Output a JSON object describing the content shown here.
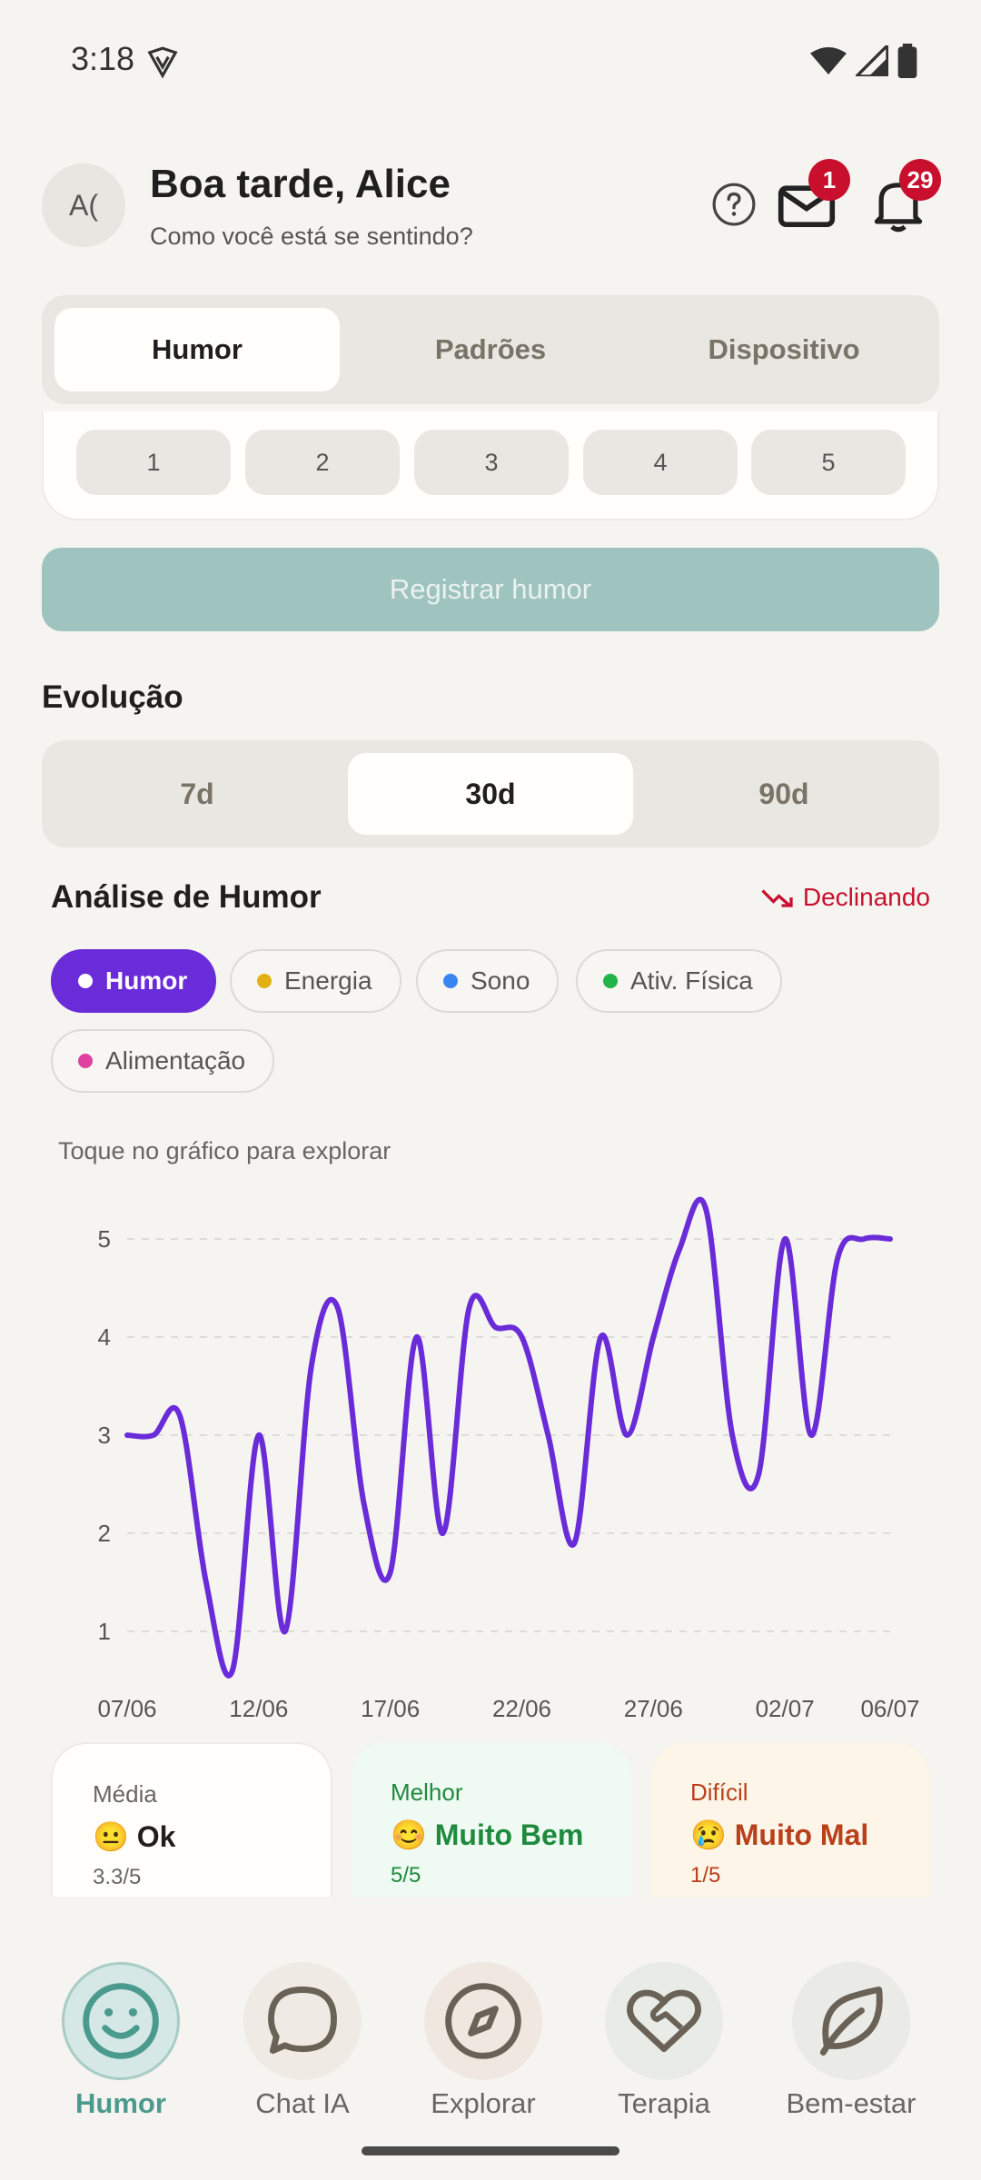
{
  "status_bar": {
    "time": "3:18"
  },
  "header": {
    "avatar_initials": "A(",
    "greeting": "Boa tarde, Alice",
    "subtitle": "Como você está se sentindo?",
    "mail_badge": "1",
    "bell_badge": "29"
  },
  "main_tabs": [
    "Humor",
    "Padrões",
    "Dispositivo"
  ],
  "rating_options": [
    "1",
    "2",
    "3",
    "4",
    "5"
  ],
  "register_button": "Registrar humor",
  "section_title": "Evolução",
  "range_tabs": [
    "7d",
    "30d",
    "90d"
  ],
  "analysis": {
    "title": "Análise de Humor",
    "trend": "Declinando",
    "chips": [
      {
        "label": "Humor",
        "color": "#6a2bd8",
        "active": true
      },
      {
        "label": "Energia",
        "color": "#e1b012",
        "active": false
      },
      {
        "label": "Sono",
        "color": "#3a86f0",
        "active": false
      },
      {
        "label": "Ativ. Física",
        "color": "#22b34a",
        "active": false
      },
      {
        "label": "Alimentação",
        "color": "#e040a0",
        "active": false
      }
    ],
    "hint": "Toque no gráfico para explorar"
  },
  "chart_data": {
    "type": "line",
    "x": [
      "07/06",
      "08/06",
      "09/06",
      "10/06",
      "11/06",
      "12/06",
      "13/06",
      "14/06",
      "15/06",
      "16/06",
      "17/06",
      "18/06",
      "19/06",
      "20/06",
      "21/06",
      "22/06",
      "23/06",
      "24/06",
      "25/06",
      "26/06",
      "27/06",
      "28/06",
      "29/06",
      "30/06",
      "01/07",
      "02/07",
      "03/07",
      "04/07",
      "05/07",
      "06/07"
    ],
    "tick_labels": [
      "07/06",
      "12/06",
      "17/06",
      "22/06",
      "27/06",
      "02/07",
      "06/07"
    ],
    "series": [
      {
        "color": "#6a2bd8",
        "values": [
          3,
          3,
          3.2,
          1.5,
          0.6,
          3,
          1,
          3.7,
          4.3,
          2.3,
          1.6,
          4,
          2,
          4.3,
          4.1,
          4,
          3,
          1.9,
          4,
          3,
          4,
          4.9,
          5.3,
          3,
          2.6,
          5,
          3,
          4.8,
          5,
          5
        ]
      }
    ],
    "yticks": [
      1,
      2,
      3,
      4,
      5
    ],
    "ylim": [
      0.5,
      5.5
    ],
    "grid": true
  },
  "stats": [
    {
      "label": "Média",
      "emoji": "😐",
      "value": "Ok",
      "sub": "3.3/5"
    },
    {
      "label": "Melhor",
      "emoji": "😊",
      "value": "Muito Bem",
      "sub": "5/5"
    },
    {
      "label": "Difícil",
      "emoji": "😢",
      "value": "Muito Mal",
      "sub": "1/5"
    }
  ],
  "nav": [
    "Humor",
    "Chat IA",
    "Explorar",
    "Terapia",
    "Bem-estar"
  ]
}
